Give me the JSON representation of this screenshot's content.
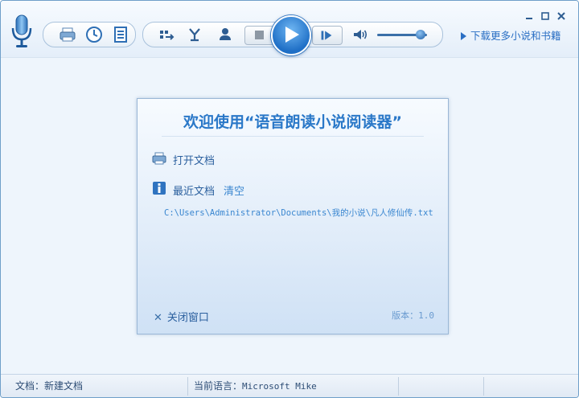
{
  "toolbar": {
    "download_more_label": "下载更多小说和书籍",
    "volume_level": 0.87,
    "icons": [
      "mic-icon",
      "print-icon",
      "clock-icon",
      "list-icon",
      "swap-icon",
      "merge-icon",
      "user-icon",
      "stop-icon",
      "play-icon",
      "next-icon",
      "volume-icon"
    ]
  },
  "dialog": {
    "title": "欢迎使用“语音朗读小说阅读器”",
    "open_document": "打开文档",
    "recent_documents": "最近文档",
    "clear": "清空",
    "recent_path": "C:\\Users\\Administrator\\Documents\\我的小说\\凡人修仙传.txt",
    "close_window": "关闭窗口",
    "version": "版本：1.0"
  },
  "status": {
    "doc_label": "文档：",
    "doc_value": "新建文档",
    "lang_label": "当前语言：",
    "lang_value": "Microsoft Mike"
  },
  "colors": {
    "accent": "#2a78c8",
    "link": "#3a86d0",
    "background": "#eef5fc"
  }
}
